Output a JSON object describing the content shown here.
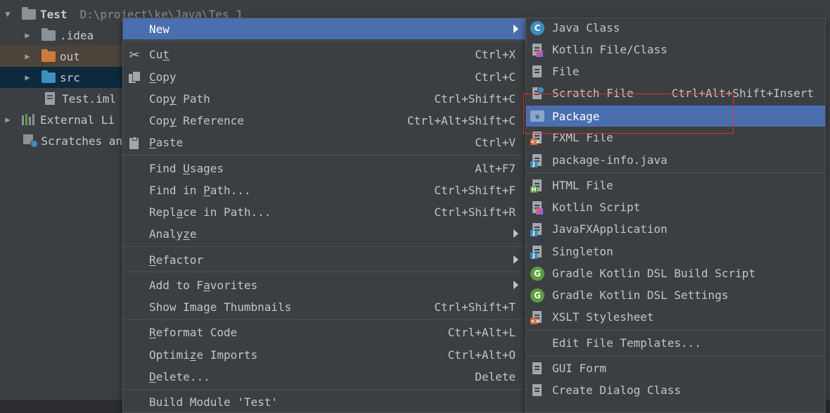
{
  "tree": {
    "root": {
      "label": "Test",
      "path": "D:\\project\\ke\\Java\\Tes",
      "extra": "1"
    },
    "items": [
      {
        "label": ".idea"
      },
      {
        "label": "out"
      },
      {
        "label": "src"
      },
      {
        "label": "Test.iml"
      },
      {
        "label": "External Li"
      },
      {
        "label": "Scratches an"
      }
    ]
  },
  "context_menu": {
    "new": {
      "label": "New"
    },
    "cut": {
      "pre": "Cu",
      "u": "t",
      "post": "",
      "shortcut": "Ctrl+X"
    },
    "copy": {
      "pre": "",
      "u": "C",
      "post": "opy",
      "shortcut": "Ctrl+C"
    },
    "copy_path": {
      "pre": "Cop",
      "u": "y",
      "post": " Path",
      "shortcut": "Ctrl+Shift+C"
    },
    "copy_reference": {
      "pre": "Cop",
      "u": "y",
      "post": " Reference",
      "shortcut": "Ctrl+Alt+Shift+C"
    },
    "paste": {
      "pre": "",
      "u": "P",
      "post": "aste",
      "shortcut": "Ctrl+V"
    },
    "find_usages": {
      "pre": "Find ",
      "u": "U",
      "post": "sages",
      "shortcut": "Alt+F7"
    },
    "find_in_path": {
      "pre": "Find in ",
      "u": "P",
      "post": "ath...",
      "shortcut": "Ctrl+Shift+F"
    },
    "replace_in_path": {
      "pre": "Repl",
      "u": "a",
      "post": "ce in Path...",
      "shortcut": "Ctrl+Shift+R"
    },
    "analyze": {
      "pre": "Analy",
      "u": "z",
      "post": "e"
    },
    "refactor": {
      "pre": "",
      "u": "R",
      "post": "efactor"
    },
    "add_to_favorites": {
      "pre": "Add to F",
      "u": "a",
      "post": "vorites"
    },
    "show_image_thumbnails": {
      "label": "Show Image Thumbnails",
      "shortcut": "Ctrl+Shift+T"
    },
    "reformat_code": {
      "pre": "",
      "u": "R",
      "post": "eformat Code",
      "shortcut": "Ctrl+Alt+L"
    },
    "optimize_imports": {
      "pre": "Optimi",
      "u": "z",
      "post": "e Imports",
      "shortcut": "Ctrl+Alt+O"
    },
    "delete": {
      "pre": "",
      "u": "D",
      "post": "elete...",
      "shortcut": "Delete"
    },
    "build_module": {
      "label": "Build Module 'Test'"
    }
  },
  "new_submenu": [
    {
      "label": "Java Class",
      "icon": "java-class-icon"
    },
    {
      "label": "Kotlin File/Class",
      "icon": "kotlin-file-icon"
    },
    {
      "label": "File",
      "icon": "file-icon"
    },
    {
      "label": "Scratch File",
      "shortcut": "Ctrl+Alt+Shift+Insert",
      "icon": "scratch-file-icon"
    },
    {
      "label": "Package",
      "icon": "package-icon",
      "selected": true
    },
    {
      "label": "FXML File",
      "icon": "fxml-file-icon"
    },
    {
      "label": "package-info.java",
      "icon": "java-file-icon"
    },
    {
      "label": "HTML File",
      "icon": "html-file-icon"
    },
    {
      "label": "Kotlin Script",
      "icon": "kotlin-script-icon"
    },
    {
      "label": "JavaFXApplication",
      "icon": "javafx-icon"
    },
    {
      "label": "Singleton",
      "icon": "singleton-icon"
    },
    {
      "label": "Gradle Kotlin DSL Build Script",
      "icon": "gradle-icon"
    },
    {
      "label": "Gradle Kotlin DSL Settings",
      "icon": "gradle-icon"
    },
    {
      "label": "XSLT Stylesheet",
      "icon": "xslt-icon"
    },
    {
      "label": "Edit File Templates...",
      "icon": ""
    },
    {
      "label": "GUI Form",
      "icon": "gui-form-icon"
    },
    {
      "label": "Create Dialog Class",
      "icon": "dialog-class-icon"
    }
  ],
  "colors": {
    "menu_bg": "#3c3f41",
    "selection": "#4b6eaf",
    "highlight_box": "#e03030"
  }
}
